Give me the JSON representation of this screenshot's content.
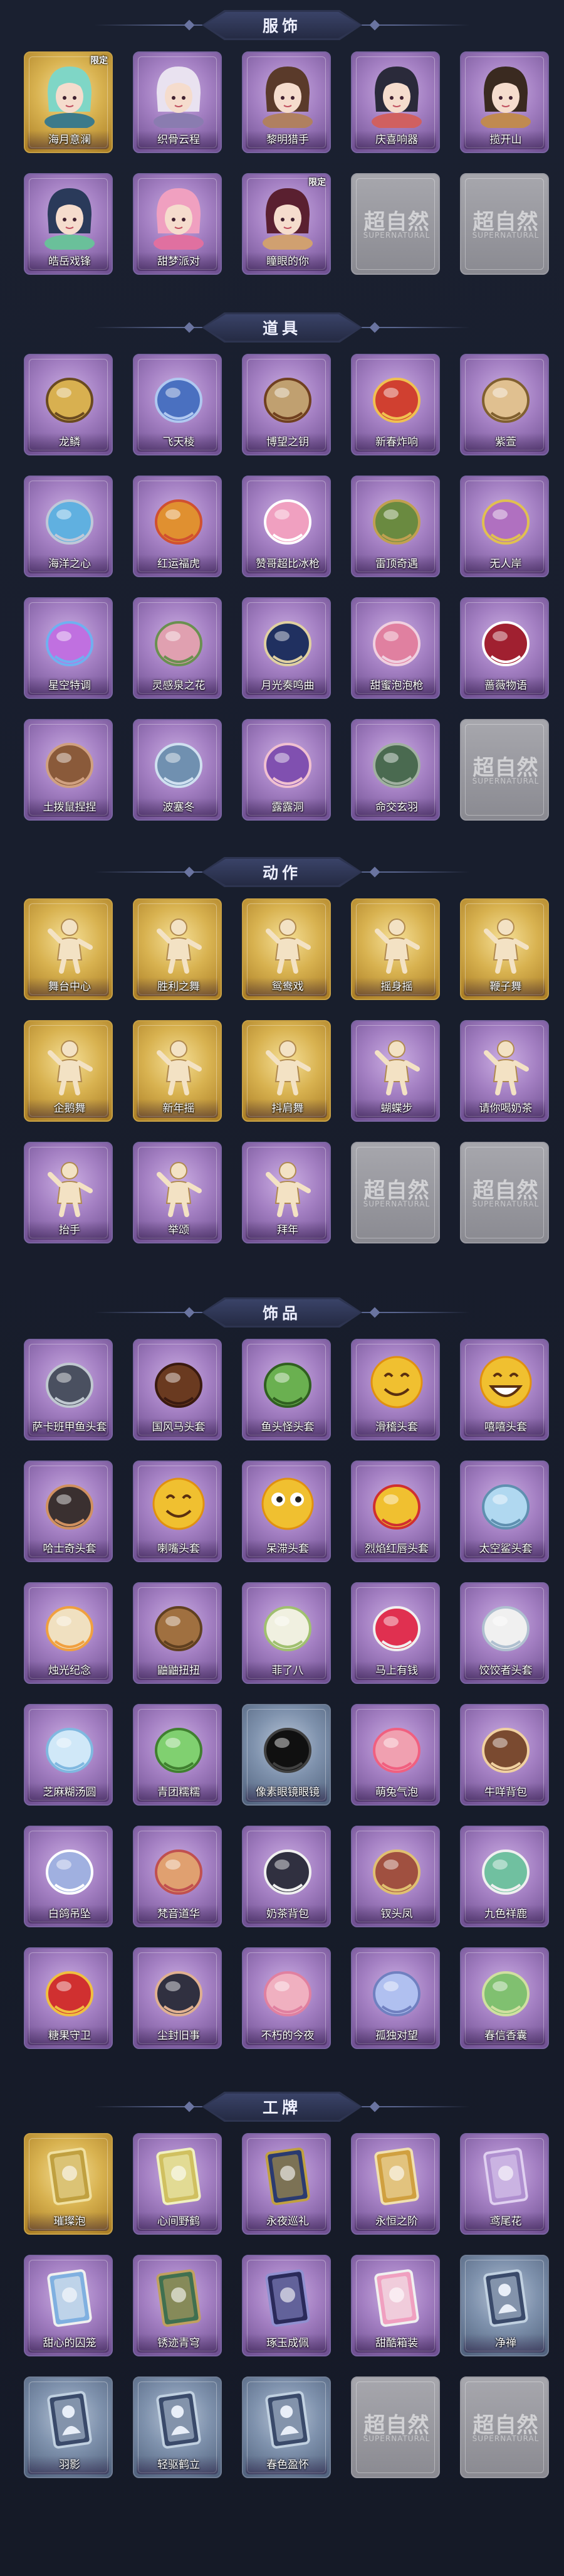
{
  "sections": [
    {
      "title": "服饰",
      "items": [
        {
          "label": "海月意澜",
          "style": "gold",
          "badge": "限定",
          "icon": "character-costume-icon",
          "c1": "#7fd6c6",
          "c2": "#3c7a8a"
        },
        {
          "label": "织骨云程",
          "style": "purple",
          "badge": "",
          "icon": "character-costume-icon",
          "c1": "#e9e2f0",
          "c2": "#8a7cb0"
        },
        {
          "label": "黎明猎手",
          "style": "purple",
          "badge": "",
          "icon": "character-costume-icon",
          "c1": "#5a3a2a",
          "c2": "#b08060"
        },
        {
          "label": "庆喜响器",
          "style": "purple",
          "badge": "",
          "icon": "character-costume-icon",
          "c1": "#2a2a3a",
          "c2": "#d06060"
        },
        {
          "label": "揽开山",
          "style": "purple",
          "badge": "",
          "icon": "character-costume-icon",
          "c1": "#3a2a20",
          "c2": "#c08a50"
        },
        {
          "label": "皓岳戏锋",
          "style": "purple",
          "badge": "",
          "icon": "character-costume-icon",
          "c1": "#2a3a5a",
          "c2": "#6ac09a"
        },
        {
          "label": "甜梦派对",
          "style": "purple",
          "badge": "",
          "icon": "character-costume-icon",
          "c1": "#f0a0c0",
          "c2": "#e070a0"
        },
        {
          "label": "瞳眼的你",
          "style": "purple",
          "badge": "限定",
          "icon": "character-costume-icon",
          "c1": "#5a2030",
          "c2": "#d0a070"
        },
        {
          "label": "",
          "style": "empty",
          "badge": "",
          "icon": "empty-slot-icon"
        },
        {
          "label": "",
          "style": "empty",
          "badge": "",
          "icon": "empty-slot-icon"
        }
      ]
    },
    {
      "title": "道具",
      "items": [
        {
          "label": "龙鳞",
          "style": "purple",
          "icon": "shovel-icon",
          "c1": "#d8b050",
          "c2": "#6a4a20"
        },
        {
          "label": "飞天棱",
          "style": "purple",
          "icon": "spear-icon",
          "c1": "#4a70c0",
          "c2": "#b0c8f0"
        },
        {
          "label": "博望之钥",
          "style": "purple",
          "icon": "whip-icon",
          "c1": "#c0a070",
          "c2": "#704020"
        },
        {
          "label": "新春炸响",
          "style": "purple",
          "icon": "firecracker-icon",
          "c1": "#d04030",
          "c2": "#f0c050"
        },
        {
          "label": "紫萱",
          "style": "purple",
          "icon": "racket-icon",
          "c1": "#e0c090",
          "c2": "#806030"
        },
        {
          "label": "海洋之心",
          "style": "purple",
          "icon": "necklace-icon",
          "c1": "#60b0e0",
          "c2": "#c0c8d8"
        },
        {
          "label": "红运福虎",
          "style": "purple",
          "icon": "tiger-icon",
          "c1": "#e09030",
          "c2": "#d05030"
        },
        {
          "label": "赞哥超比冰枪",
          "style": "purple",
          "icon": "ice-gun-icon",
          "c1": "#f0a0c0",
          "c2": "#ffffff"
        },
        {
          "label": "雷顶奇遇",
          "style": "purple",
          "icon": "gadget-icon",
          "c1": "#6a8a40",
          "c2": "#c0a050"
        },
        {
          "label": "无人岸",
          "style": "purple",
          "icon": "potion-icon",
          "c1": "#b070c0",
          "c2": "#e0c050"
        },
        {
          "label": "星空特调",
          "style": "purple",
          "icon": "gem-icon",
          "c1": "#c070e0",
          "c2": "#70b0f0"
        },
        {
          "label": "灵感泉之花",
          "style": "purple",
          "icon": "flower-icon",
          "c1": "#e0a0b0",
          "c2": "#6a9050"
        },
        {
          "label": "月光奏鸣曲",
          "style": "purple",
          "icon": "piano-icon",
          "c1": "#203060",
          "c2": "#e0d0a0"
        },
        {
          "label": "甜蜜泡泡枪",
          "style": "purple",
          "icon": "bubble-gun-icon",
          "c1": "#e080a0",
          "c2": "#f0d0e0"
        },
        {
          "label": "蔷薇物语",
          "style": "purple",
          "icon": "first-aid-kit-icon",
          "c1": "#a02030",
          "c2": "#ffffff"
        },
        {
          "label": "土拨鼠捏捏",
          "style": "purple",
          "icon": "groundhog-icon",
          "c1": "#8a5a3a",
          "c2": "#d0a080"
        },
        {
          "label": "波塞冬",
          "style": "purple",
          "icon": "trident-icon",
          "c1": "#7090b0",
          "c2": "#d0e0f0"
        },
        {
          "label": "露露洞",
          "style": "purple",
          "icon": "doll-icon",
          "c1": "#8050b0",
          "c2": "#f0c0d0"
        },
        {
          "label": "命交玄羽",
          "style": "purple",
          "icon": "lantern-icon",
          "c1": "#4a6a50",
          "c2": "#a0b0a0"
        },
        {
          "label": "",
          "style": "empty",
          "icon": "empty-slot-icon"
        }
      ]
    },
    {
      "title": "动作",
      "items": [
        {
          "label": "舞台中心",
          "style": "gold",
          "icon": "pose-icon"
        },
        {
          "label": "胜利之舞",
          "style": "gold",
          "icon": "pose-icon"
        },
        {
          "label": "鸳鸯戏",
          "style": "gold",
          "icon": "pose-icon"
        },
        {
          "label": "摇身摇",
          "style": "gold",
          "icon": "pose-icon"
        },
        {
          "label": "鞭子舞",
          "style": "gold",
          "icon": "pose-icon"
        },
        {
          "label": "企鹅舞",
          "style": "gold",
          "icon": "pose-icon"
        },
        {
          "label": "新年摇",
          "style": "gold",
          "icon": "pose-icon"
        },
        {
          "label": "抖肩舞",
          "style": "gold",
          "icon": "pose-icon"
        },
        {
          "label": "蝴蝶步",
          "style": "purple",
          "icon": "pose-icon"
        },
        {
          "label": "请你喝奶茶",
          "style": "purple",
          "icon": "pose-icon"
        },
        {
          "label": "抬手",
          "style": "purple",
          "icon": "pose-icon"
        },
        {
          "label": "举颂",
          "style": "purple",
          "icon": "pose-icon"
        },
        {
          "label": "拜年",
          "style": "purple",
          "icon": "pose-icon"
        },
        {
          "label": "",
          "style": "empty",
          "icon": "empty-slot-icon"
        },
        {
          "label": "",
          "style": "empty",
          "icon": "empty-slot-icon"
        }
      ]
    },
    {
      "title": "饰品",
      "items": [
        {
          "label": "萨卡班甲鱼头套",
          "style": "purple",
          "icon": "fish-head-icon",
          "c1": "#4a5060",
          "c2": "#c0c8d0"
        },
        {
          "label": "国风马头套",
          "style": "purple",
          "icon": "horse-head-icon",
          "c1": "#6a3a20",
          "c2": "#3a1a10"
        },
        {
          "label": "鱼头怪头套",
          "style": "purple",
          "icon": "fish-monster-icon",
          "c1": "#6ab050",
          "c2": "#306020"
        },
        {
          "label": "滑稽头套",
          "style": "purple",
          "icon": "smiley-icon",
          "c1": "#f0c030",
          "c2": "#e09010"
        },
        {
          "label": "嘻嘻头套",
          "style": "purple",
          "icon": "grin-icon",
          "c1": "#f0c030",
          "c2": "#e09010"
        },
        {
          "label": "哈士奇头套",
          "style": "purple",
          "icon": "husky-icon",
          "c1": "#3a3030",
          "c2": "#d09060"
        },
        {
          "label": "喇嘴头套",
          "style": "purple",
          "icon": "emoji-icon",
          "c1": "#f0c030",
          "c2": "#e09010"
        },
        {
          "label": "呆滞头套",
          "style": "purple",
          "icon": "dazed-icon",
          "c1": "#f0c030",
          "c2": "#e09010"
        },
        {
          "label": "烈焰红唇头套",
          "style": "purple",
          "icon": "yellow-mascot-icon",
          "c1": "#f0c030",
          "c2": "#d03030"
        },
        {
          "label": "太空鲨头套",
          "style": "purple",
          "icon": "shark-head-icon",
          "c1": "#b0d8f0",
          "c2": "#6090b0"
        },
        {
          "label": "烛光纪念",
          "style": "purple",
          "icon": "candle-icon",
          "c1": "#f0e0c0",
          "c2": "#f0a040"
        },
        {
          "label": "鼬鼬扭扭",
          "style": "purple",
          "icon": "weasel-icon",
          "c1": "#a07040",
          "c2": "#604020"
        },
        {
          "label": "菲了八",
          "style": "purple",
          "icon": "garlic-icon",
          "c1": "#f0f0e0",
          "c2": "#a0c070"
        },
        {
          "label": "马上有钱",
          "style": "purple",
          "icon": "horse-charm-icon",
          "c1": "#e03050",
          "c2": "#f0f0f0"
        },
        {
          "label": "饺饺者头套",
          "style": "purple",
          "icon": "dumpling-icon",
          "c1": "#f0f0f0",
          "c2": "#b0c0d0"
        },
        {
          "label": "芝麻糊汤圆",
          "style": "purple",
          "icon": "rice-ball-icon",
          "c1": "#d0e8f8",
          "c2": "#80b8e0"
        },
        {
          "label": "青团糯糯",
          "style": "purple",
          "icon": "green-ball-icon",
          "c1": "#80d070",
          "c2": "#408030"
        },
        {
          "label": "像素眼镜眼镜",
          "style": "blue",
          "icon": "pixel-glasses-icon",
          "c1": "#101010",
          "c2": "#404040"
        },
        {
          "label": "萌兔气泡",
          "style": "purple",
          "icon": "rabbit-bubble-icon",
          "c1": "#f0a0b0",
          "c2": "#f06080"
        },
        {
          "label": "牛咩背包",
          "style": "purple",
          "icon": "backpack-icon",
          "c1": "#7a4a30",
          "c2": "#f0d0a0"
        },
        {
          "label": "白鸽吊坠",
          "style": "purple",
          "icon": "dove-pendant-icon",
          "c1": "#a0b0e0",
          "c2": "#ffffff"
        },
        {
          "label": "梵音道华",
          "style": "purple",
          "icon": "figure-charm-icon",
          "c1": "#e0a070",
          "c2": "#c05050"
        },
        {
          "label": "奶茶背包",
          "style": "purple",
          "icon": "milk-tea-tag-icon",
          "c1": "#303040",
          "c2": "#f0f0f0"
        },
        {
          "label": "钗头凤",
          "style": "purple",
          "icon": "hairpin-figure-icon",
          "c1": "#a05040",
          "c2": "#e0c070"
        },
        {
          "label": "九色祥鹿",
          "style": "purple",
          "icon": "deer-charm-icon",
          "c1": "#70c0a0",
          "c2": "#f0f0f0"
        },
        {
          "label": "糖果守卫",
          "style": "purple",
          "icon": "candy-guard-icon",
          "c1": "#d03030",
          "c2": "#f0c040"
        },
        {
          "label": "尘封旧事",
          "style": "purple",
          "icon": "chibi-figure-icon",
          "c1": "#303040",
          "c2": "#e0b090"
        },
        {
          "label": "不朽的今夜",
          "style": "purple",
          "icon": "flower-charm-icon",
          "c1": "#f0b0c0",
          "c2": "#e080a0"
        },
        {
          "label": "孤独对望",
          "style": "purple",
          "icon": "crystal-charm-icon",
          "c1": "#b0c0f0",
          "c2": "#7080c0"
        },
        {
          "label": "春信香囊",
          "style": "purple",
          "icon": "sachet-icon",
          "c1": "#80c070",
          "c2": "#d0e0a0"
        }
      ]
    },
    {
      "title": "工牌",
      "items": [
        {
          "label": "璀璨泡",
          "style": "gold",
          "icon": "badge-card-icon",
          "c1": "#c0a040",
          "c2": "#f0e0a0"
        },
        {
          "label": "心间野鹤",
          "style": "purple",
          "icon": "badge-card-icon",
          "c1": "#d0c060",
          "c2": "#f0f0c0"
        },
        {
          "label": "永夜巡礼",
          "style": "purple",
          "icon": "badge-card-icon",
          "c1": "#2a3a70",
          "c2": "#c0a040"
        },
        {
          "label": "永恒之阶",
          "style": "purple",
          "icon": "badge-card-icon",
          "c1": "#d0a040",
          "c2": "#f0e0b0"
        },
        {
          "label": "鸢尾花",
          "style": "purple",
          "icon": "badge-card-icon",
          "c1": "#b090d0",
          "c2": "#e0d0f0"
        },
        {
          "label": "甜心的囚笼",
          "style": "purple",
          "icon": "badge-card-icon",
          "c1": "#80b0e0",
          "c2": "#f0f0f0"
        },
        {
          "label": "锈迹青穹",
          "style": "purple",
          "icon": "badge-card-icon",
          "c1": "#407050",
          "c2": "#c0a060"
        },
        {
          "label": "琢玉成佩",
          "style": "purple",
          "icon": "badge-card-icon",
          "c1": "#2a2a5a",
          "c2": "#9090d0"
        },
        {
          "label": "甜酷箱装",
          "style": "purple",
          "icon": "badge-card-icon",
          "c1": "#f0a0c0",
          "c2": "#f0f0f0"
        },
        {
          "label": "净禅",
          "style": "blue",
          "icon": "silhouette-card-icon",
          "c1": "#3a4a6a",
          "c2": "#c0d0e0"
        },
        {
          "label": "羽影",
          "style": "blue",
          "icon": "silhouette-card-icon",
          "c1": "#3a4a6a",
          "c2": "#c0d0e0"
        },
        {
          "label": "轻驱鹤立",
          "style": "blue",
          "icon": "silhouette-card-icon",
          "c1": "#3a4a6a",
          "c2": "#c0d0e0"
        },
        {
          "label": "春色盈怀",
          "style": "blue",
          "icon": "silhouette-card-icon",
          "c1": "#3a4a6a",
          "c2": "#c0d0e0"
        },
        {
          "label": "",
          "style": "empty",
          "icon": "empty-slot-icon"
        },
        {
          "label": "",
          "style": "empty",
          "icon": "empty-slot-icon"
        }
      ]
    }
  ],
  "empty_slot": {
    "mark": "超自然",
    "sub": "SUPERNATURAL"
  }
}
